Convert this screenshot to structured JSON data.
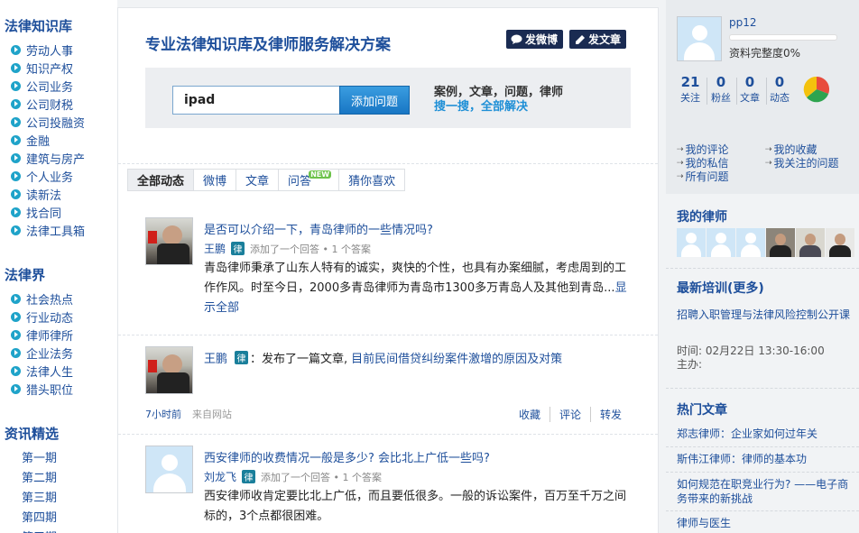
{
  "left": {
    "section1_title": "法律知识库",
    "section1_items": [
      "劳动人事",
      "知识产权",
      "公司业务",
      "公司财税",
      "公司投融资",
      "金融",
      "建筑与房产",
      "个人业务",
      "读新法",
      "找合同",
      "法律工具箱"
    ],
    "section2_title": "法律界",
    "section2_items": [
      "社会热点",
      "行业动态",
      "律师律所",
      "企业法务",
      "法律人生",
      "猎头职位"
    ],
    "section3_title": "资讯精选",
    "section3_items": [
      "第一期",
      "第二期",
      "第三期",
      "第四期",
      "第五期"
    ]
  },
  "center": {
    "title": "专业法律知识库及律师服务解决方案",
    "weibo_btn": "发微博",
    "article_btn": "发文章",
    "search": {
      "value": "ipad",
      "button": "添加问题",
      "hint1": "案例，文章，问题，律师",
      "hint2": "搜一搜，全部解决"
    },
    "tabs": [
      "全部动态",
      "微博",
      "文章",
      "问答",
      "猜你喜欢"
    ],
    "new_badge": "NEW",
    "lv_badge": "律",
    "feed": [
      {
        "title": "是否可以介绍一下，青岛律师的一些情况吗?",
        "author": "王鹏",
        "meta": "添加了一个回答 • 1 个答案",
        "body": "青岛律师秉承了山东人特有的诚实，爽快的个性，也具有办案细腻，考虑周到的工作作风。时至今日，2000多青岛律师为青岛市1300多万青岛人及其他到青岛...",
        "more": "显示全部"
      },
      {
        "author": "王鹏",
        "action": "：发布了一篇文章,",
        "article": "目前民间借贷纠纷案件激增的原因及对策",
        "time": "7小时前",
        "source": "来自网站",
        "actions": [
          "收藏",
          "评论",
          "转发"
        ]
      },
      {
        "title": "西安律师的收费情况一般是多少? 会比北上广低一些吗?",
        "author": "刘龙飞",
        "meta": "添加了一个回答 • 1 个答案",
        "body": "西安律师收肯定要比北上广低，而且要低很多。一般的诉讼案件，百万至千万之间标的，3个点都很困难。"
      }
    ]
  },
  "right": {
    "username": "pp12",
    "completion": "资料完整度0%",
    "completion_fraction": 0,
    "stats": [
      {
        "num": "21",
        "label": "关注"
      },
      {
        "num": "0",
        "label": "粉丝"
      },
      {
        "num": "0",
        "label": "文章"
      },
      {
        "num": "0",
        "label": "动态"
      }
    ],
    "links_left": [
      "我的评论",
      "我的私信",
      "所有问题"
    ],
    "links_right": [
      "我的收藏",
      "我关注的问题"
    ],
    "my_lawyers_title": "我的律师",
    "training_title": "最新培训(更多)",
    "training_item": "招聘入职管理与法律风险控制公开课",
    "training_time": "时间: 02月22日 13:30-16:00",
    "training_host": "主办:",
    "hot_title": "热门文章",
    "hot_items": [
      "郑志律师：企业家如何过年关",
      "斯伟江律师：律师的基本功",
      "如何规范在职竞业行为? ——电子商务带来的新挑战",
      "律师与医生"
    ]
  }
}
